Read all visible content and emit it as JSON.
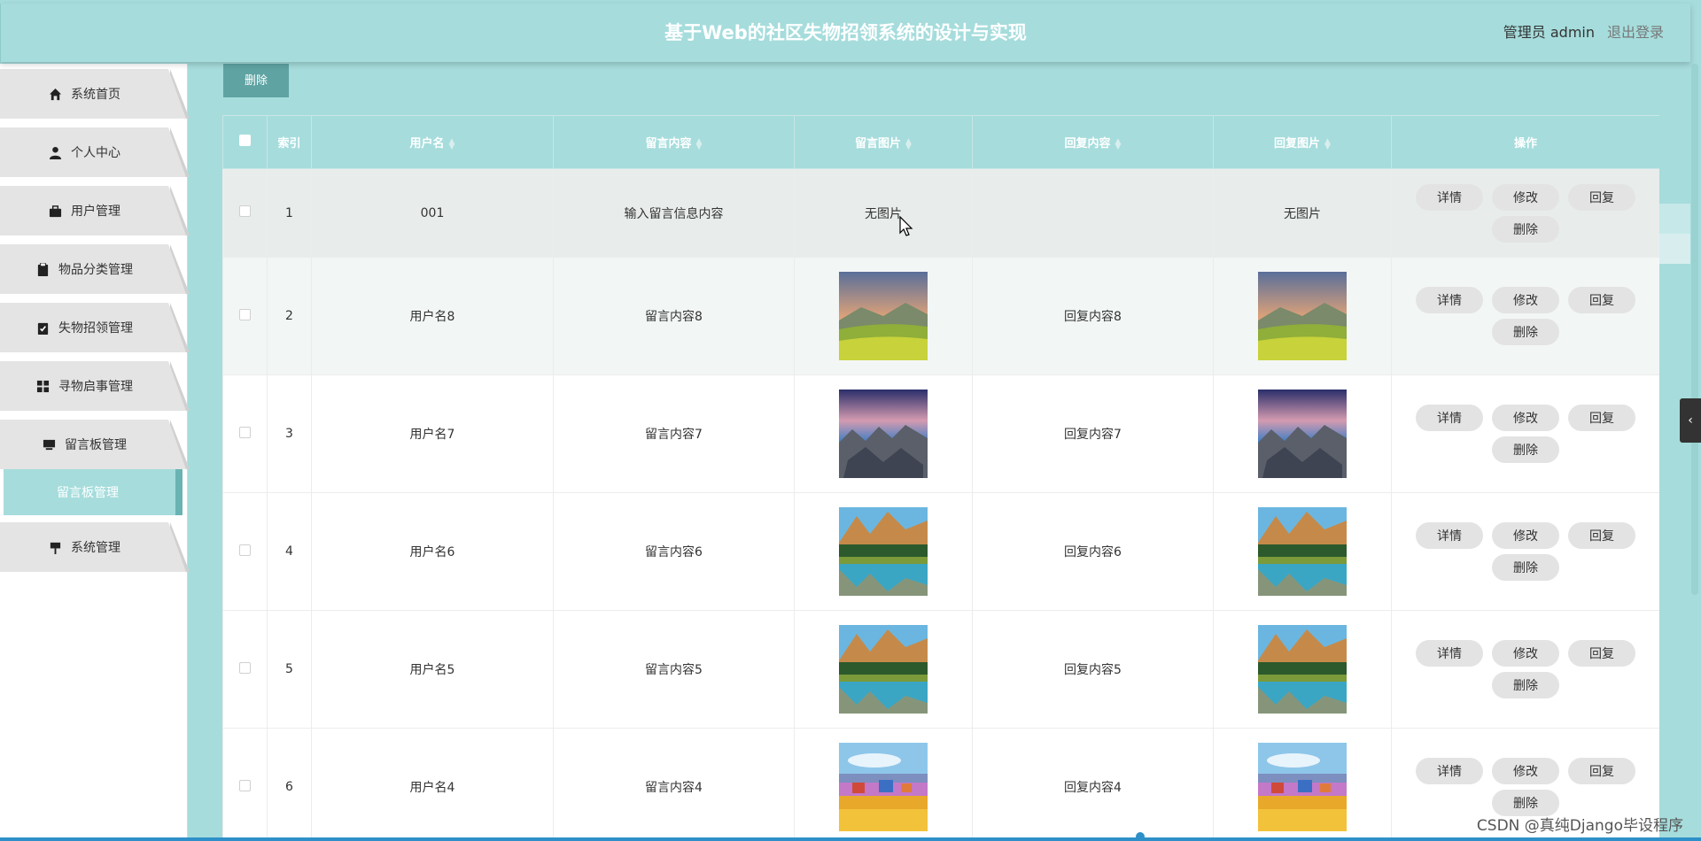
{
  "header": {
    "title": "基于Web的社区失物招领系统的设计与实现",
    "user_label": "管理员 admin",
    "logout_label": "退出登录"
  },
  "sidebar": {
    "items": [
      {
        "label": "系统首页",
        "icon": "home-icon"
      },
      {
        "label": "个人中心",
        "icon": "user-icon"
      },
      {
        "label": "用户管理",
        "icon": "briefcase-icon"
      },
      {
        "label": "物品分类管理",
        "icon": "clipboard-icon"
      },
      {
        "label": "失物招领管理",
        "icon": "clipboard-check-icon"
      },
      {
        "label": "寻物启事管理",
        "icon": "grid-icon"
      },
      {
        "label": "留言板管理",
        "icon": "monitor-icon"
      },
      {
        "label": "系统管理",
        "icon": "sign-icon"
      }
    ],
    "active_sub": "留言板管理"
  },
  "toolbar": {
    "delete_label": "删除"
  },
  "table": {
    "columns": [
      "索引",
      "用户名",
      "留言内容",
      "留言图片",
      "回复内容",
      "回复图片",
      "操作"
    ],
    "rows": [
      {
        "index": "1",
        "username": "001",
        "content": "输入留言信息内容",
        "image": "无图片",
        "reply": "",
        "reply_image": "无图片"
      },
      {
        "index": "2",
        "username": "用户名8",
        "content": "留言内容8",
        "image": "meadow",
        "reply": "回复内容8",
        "reply_image": "meadow"
      },
      {
        "index": "3",
        "username": "用户名7",
        "content": "留言内容7",
        "image": "rocks",
        "reply": "回复内容7",
        "reply_image": "rocks"
      },
      {
        "index": "4",
        "username": "用户名6",
        "content": "留言内容6",
        "image": "lake",
        "reply": "回复内容6",
        "reply_image": "lake"
      },
      {
        "index": "5",
        "username": "用户名5",
        "content": "留言内容5",
        "image": "lake",
        "reply": "回复内容5",
        "reply_image": "lake"
      },
      {
        "index": "6",
        "username": "用户名4",
        "content": "留言内容4",
        "image": "village",
        "reply": "回复内容4",
        "reply_image": "village"
      }
    ],
    "actions": {
      "detail": "详情",
      "edit": "修改",
      "reply": "回复",
      "delete": "删除"
    }
  },
  "watermark": "CSDN @真纯Django毕设程序",
  "colors": {
    "accent": "#a6dcdc",
    "accent_dark": "#5fa3a3",
    "button": "#e3e3e3",
    "link_blue": "#2e90c8"
  }
}
